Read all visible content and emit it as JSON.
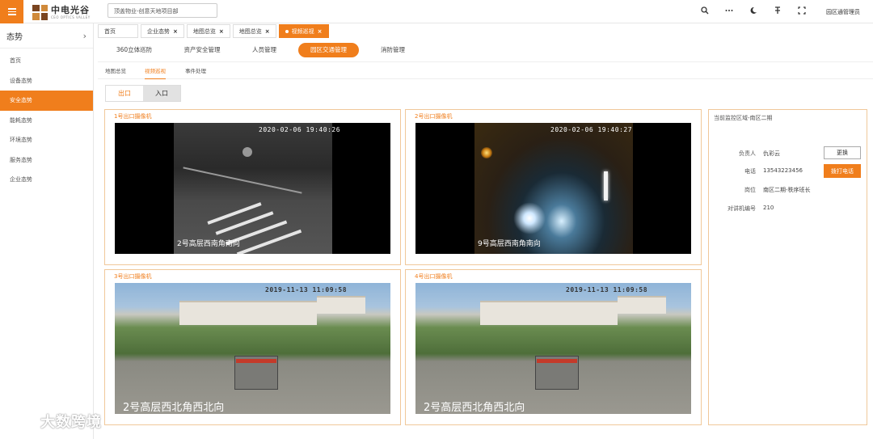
{
  "header": {
    "logo_name": "中电光谷",
    "logo_sub": "CEO OPTICS VALLEY",
    "search_value": "顶盖物业-创意天地项目部",
    "user_label": "园区通管理员",
    "icons": [
      "search-icon",
      "more-icon",
      "theme-icon",
      "pin-icon",
      "fullscreen-icon"
    ]
  },
  "sidebar": {
    "title": "态势",
    "items": [
      {
        "label": "首页",
        "active": false
      },
      {
        "label": "设备态势",
        "active": false
      },
      {
        "label": "安全态势",
        "active": true
      },
      {
        "label": "能耗态势",
        "active": false
      },
      {
        "label": "环境态势",
        "active": false
      },
      {
        "label": "服务态势",
        "active": false
      },
      {
        "label": "企业态势",
        "active": false
      }
    ]
  },
  "tabs": [
    {
      "label": "首页",
      "closable": false,
      "active": false
    },
    {
      "label": "企业态势",
      "closable": true,
      "active": false
    },
    {
      "label": "地图总览",
      "closable": true,
      "active": false
    },
    {
      "label": "地图总览",
      "closable": true,
      "active": false
    },
    {
      "label": "视频巡视",
      "closable": true,
      "active": true
    }
  ],
  "modules": [
    {
      "label": "360立体巡防",
      "active": false
    },
    {
      "label": "资产安全管理",
      "active": false
    },
    {
      "label": "人员管理",
      "active": false
    },
    {
      "label": "园区交通管理",
      "active": true
    },
    {
      "label": "消防管理",
      "active": false
    }
  ],
  "subnav": [
    {
      "label": "地图总览",
      "active": false
    },
    {
      "label": "视频巡视",
      "active": true
    },
    {
      "label": "事件处理",
      "active": false
    }
  ],
  "direction": {
    "options": [
      "出口",
      "入口"
    ],
    "selected": "出口"
  },
  "cameras": [
    {
      "title": "1号出口摄像机",
      "timestamp": "2020-02-06 19:40:26",
      "feed_label": "2号高层西南角南向"
    },
    {
      "title": "2号出口摄像机",
      "timestamp": "2020-02-06 19:40:27",
      "feed_label": "9号高层西南角南向"
    },
    {
      "title": "3号出口摄像机",
      "timestamp": "2019-11-13 11:09:58",
      "feed_label": "2号高层西北角西北向"
    },
    {
      "title": "4号出口摄像机",
      "timestamp": "2019-11-13 11:09:58",
      "feed_label": "2号高层西北角西北向"
    }
  ],
  "info": {
    "area_label": "当前监控区域-南区二期",
    "rows": [
      {
        "label": "负责人",
        "value": "仇彩云"
      },
      {
        "label": "电话",
        "value": "13543223456"
      },
      {
        "label": "岗位",
        "value": "南区二期-秩序班长"
      },
      {
        "label": "对讲机编号",
        "value": "210"
      }
    ],
    "replace_button": "更换",
    "call_button": "拨打电话"
  },
  "watermark": "大数跨境",
  "colors": {
    "accent": "#f07e1c",
    "panel_border": "#f0c89a"
  }
}
